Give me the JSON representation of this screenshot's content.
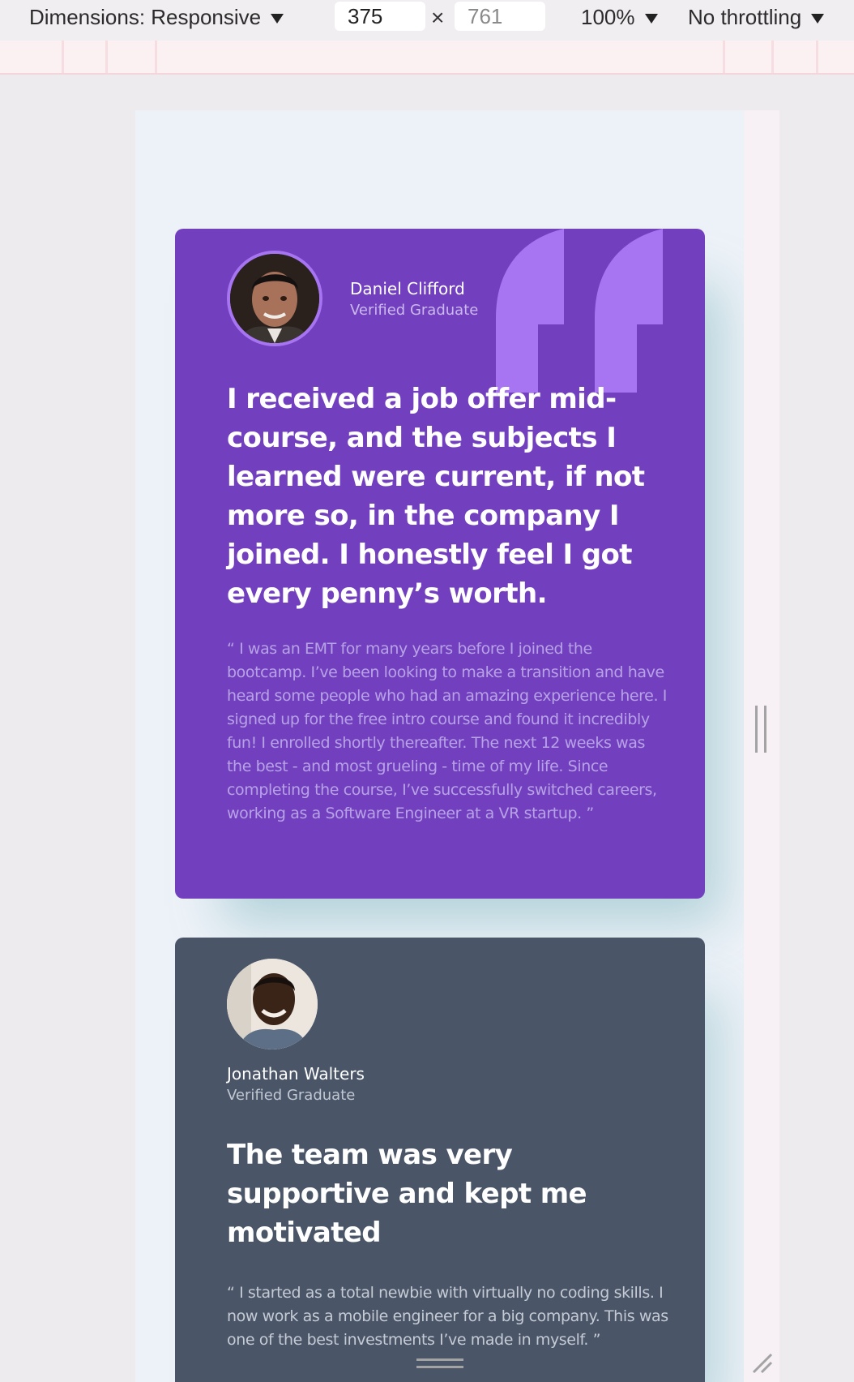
{
  "toolbar": {
    "dimensions_label": "Dimensions: Responsive",
    "width_value": "375",
    "height_value": "761",
    "times_symbol": "×",
    "zoom_label": "100%",
    "throttling_label": "No throttling"
  },
  "testimonials": [
    {
      "name": "Daniel Clifford",
      "status": "Verified Graduate",
      "headline": "I received a job offer mid-course, and the subjects I learned were current, if not more so, in the company I joined. I honestly feel I got every penny’s worth.",
      "body": "“ I was an EMT for many years before I joined the bootcamp. I’ve been looking to make a transition and have heard some people who had an amazing experience here. I signed up for the free intro course and found it incredibly fun! I enrolled shortly thereafter. The next 12 weeks was the best - and most grueling - time of my life. Since completing the course, I’ve successfully switched careers, working as a Software Engineer at a VR startup. ”"
    },
    {
      "name": "Jonathan Walters",
      "status": "Verified Graduate",
      "headline": "The team was very supportive and kept me motivated",
      "body": "“ I started as a total newbie with virtually no coding skills. I now work as a mobile engineer for a big company. This was one of the best investments I’ve made in myself. ”"
    }
  ],
  "colors": {
    "card_purple": "#7240bf",
    "card_slate": "#4a5568",
    "quote_mark": "#a775f1",
    "page_background": "#edf2f8"
  },
  "icons": {
    "quote": "quotation-mark-icon",
    "caret": "caret-down-icon",
    "resize": "resize-handle-icon"
  }
}
